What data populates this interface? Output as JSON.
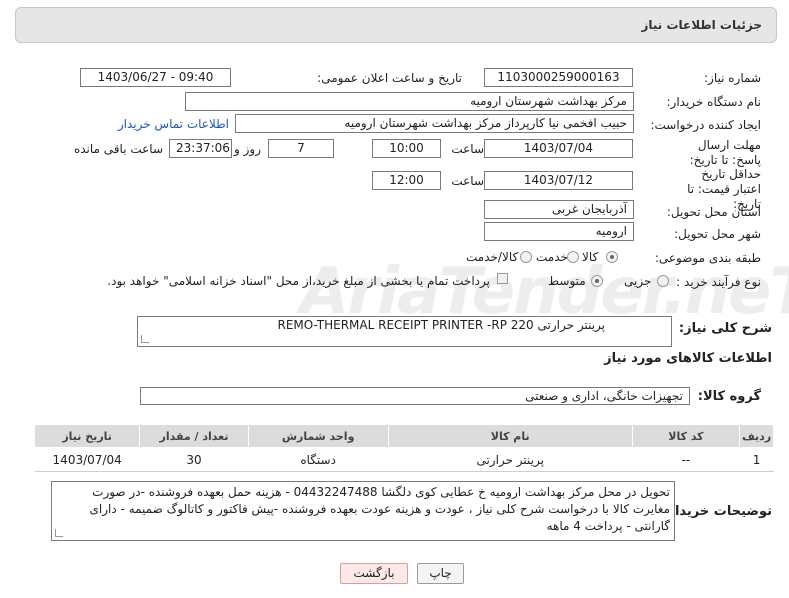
{
  "header": {
    "title": "جزئیات اطلاعات نیاز"
  },
  "need_number": {
    "label": "شماره نیاز:",
    "value": "1103000259000163"
  },
  "announce": {
    "label": "تاریخ و ساعت اعلان عمومی:",
    "value": "1403/06/27 - 09:40"
  },
  "buyer_org": {
    "label": "نام دستگاه خریدار:",
    "value": "مرکز بهداشت شهرستان ارومیه"
  },
  "requester": {
    "label": "ایجاد کننده درخواست:",
    "value": "حبیب افخمی نیا کارپرداز مرکز بهداشت شهرستان ارومیه",
    "contact_link": "اطلاعات تماس خریدار"
  },
  "deadline": {
    "label": "مهلت ارسال پاسخ: تا تاریخ:",
    "date": "1403/07/04",
    "time_label": "ساعت",
    "time": "10:00",
    "days": "7",
    "days_label": "روز و",
    "remaining": "23:37:06",
    "remaining_label": "ساعت باقی مانده"
  },
  "validity": {
    "label": "حداقل تاریخ اعتبار قیمت: تا تاریخ:",
    "date": "1403/07/12",
    "time_label": "ساعت",
    "time": "12:00"
  },
  "province": {
    "label": "استان محل تحویل:",
    "value": "آذربایجان غربی"
  },
  "city": {
    "label": "شهر محل تحویل:",
    "value": "ارومیه"
  },
  "category": {
    "label": "طبقه بندی موضوعی:",
    "options": [
      "کالا",
      "خدمت",
      "کالا/خدمت"
    ],
    "selected": "کالا"
  },
  "process": {
    "label": "نوع فرآیند خرید :",
    "options": [
      "جزیی",
      "متوسط"
    ],
    "selected": "جزیی",
    "payment_note": "پرداخت تمام یا بخشی از مبلغ خرید،از محل \"اسناد خزانه اسلامی\" خواهد بود."
  },
  "summary": {
    "label": "شرح کلی نیاز:",
    "value": "پرینتر حرارتی REMO-THERMAL RECEIPT PRINTER -RP 220"
  },
  "goods_info": {
    "title": "اطلاعات کالاهای مورد نیاز"
  },
  "goods_group": {
    "label": "گروه کالا:",
    "value": "تجهیزات خانگی، اداری و صنعتی"
  },
  "table": {
    "headers": [
      "ردیف",
      "کد کالا",
      "نام کالا",
      "واحد شمارش",
      "تعداد / مقدار",
      "تاریخ نیاز"
    ],
    "rows": [
      {
        "row": "1",
        "code": "--",
        "name": "پرینتر حرارتی",
        "unit": "دستگاه",
        "qty": "30",
        "date": "1403/07/04"
      }
    ]
  },
  "buyer_notes": {
    "label": "توضیحات خریدار:",
    "value": "تحویل در محل مرکز بهداشت ارومیه خ عطایی کوی دلگشا 04432247488 - هزینه حمل بعهده فروشنده -در صورت مغایرت کالا با درخواست شرح کلی نیاز ، عودت و هزینه عودت بعهده فروشنده -پیش فاکتور و کاتالوگ ضمیمه -  دارای گارانتی - پرداخت 4 ماهه"
  },
  "buttons": {
    "print": "چاپ",
    "back": "بازگشت"
  },
  "watermark": "AriaTender.neT"
}
